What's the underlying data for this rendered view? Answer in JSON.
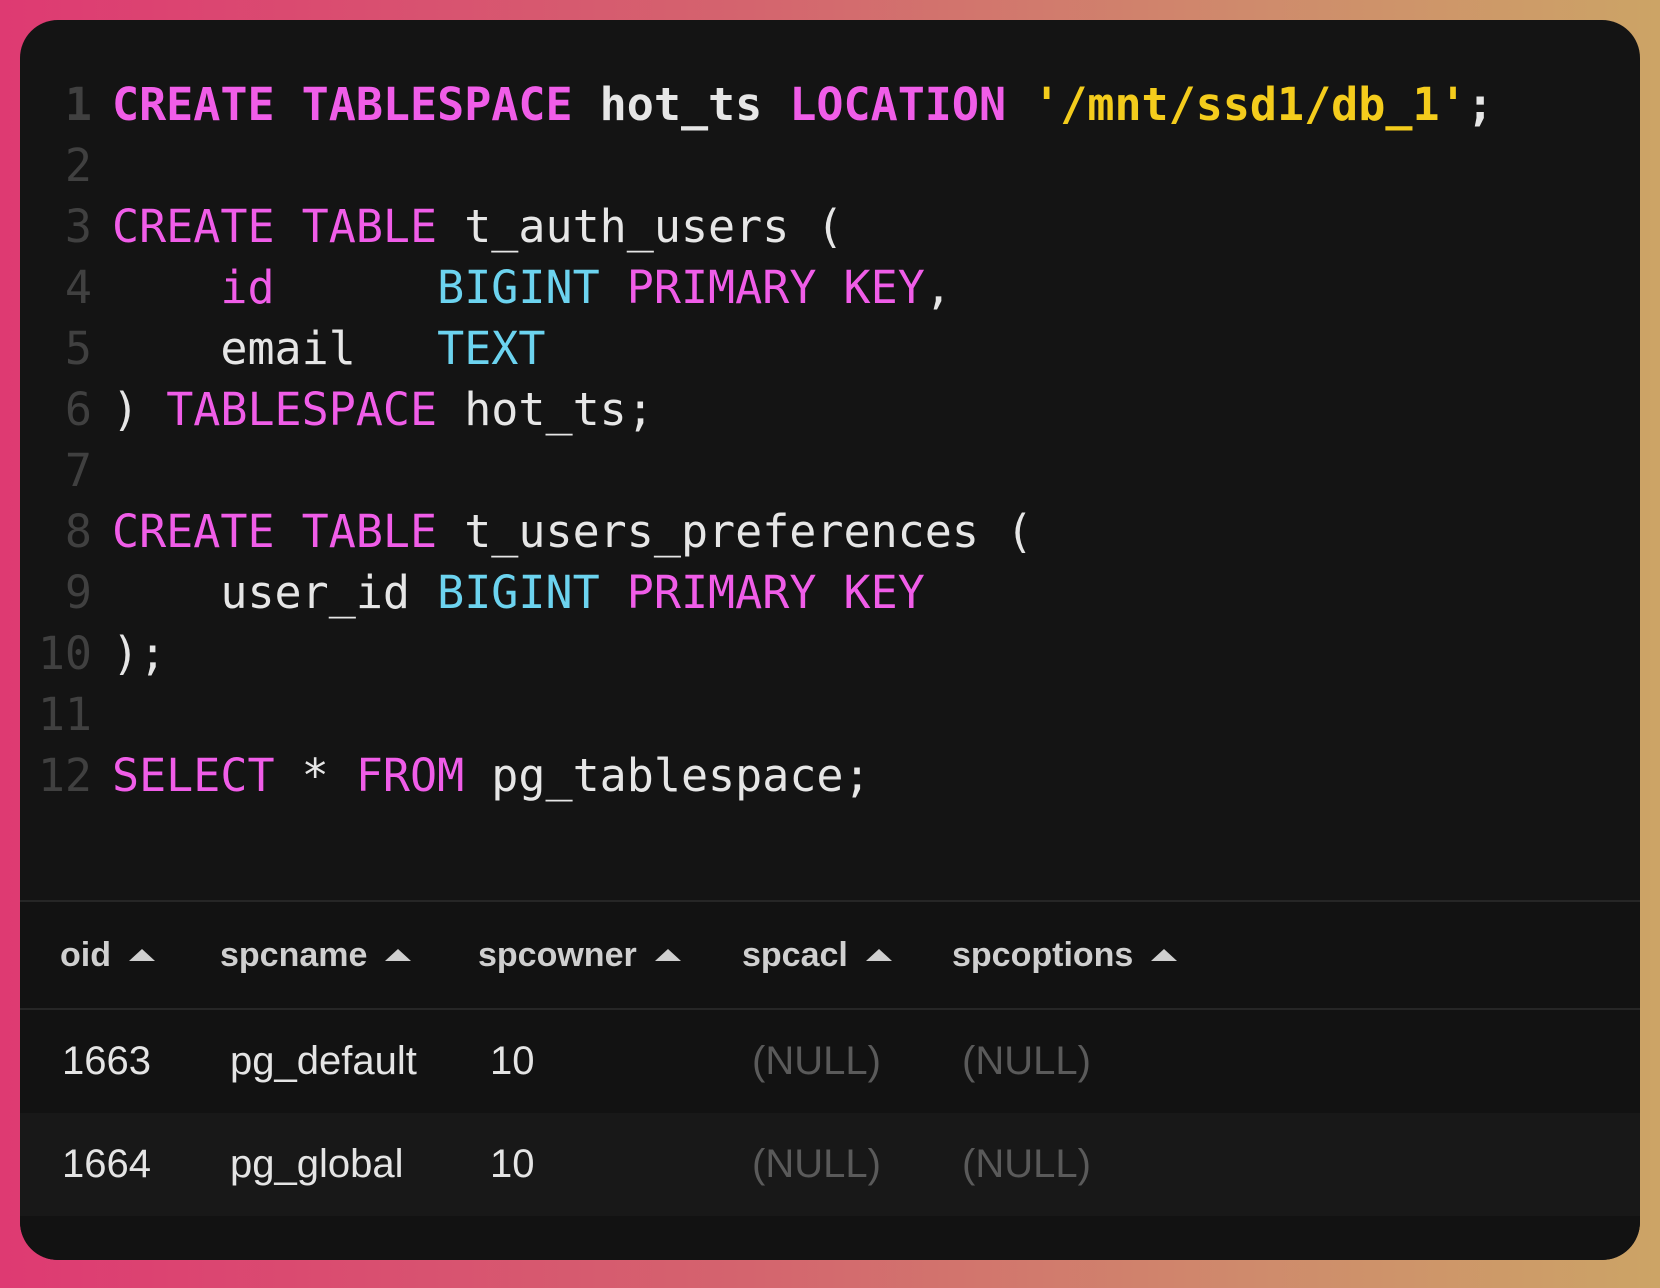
{
  "editor": {
    "lines": [
      {
        "n": "1",
        "tokens": [
          {
            "t": "CREATE TABLESPACE",
            "c": "kw"
          },
          {
            "t": " hot_ts ",
            "c": "code"
          },
          {
            "t": "LOCATION",
            "c": "kw"
          },
          {
            "t": " ",
            "c": "code"
          },
          {
            "t": "'/mnt/ssd1/db_1'",
            "c": "st"
          },
          {
            "t": ";",
            "c": "code"
          }
        ]
      },
      {
        "n": "2",
        "tokens": []
      },
      {
        "n": "3",
        "tokens": [
          {
            "t": "CREATE TABLE",
            "c": "kw"
          },
          {
            "t": " t_auth_users (",
            "c": "code"
          }
        ]
      },
      {
        "n": "4",
        "tokens": [
          {
            "t": "    ",
            "c": "code"
          },
          {
            "t": "id",
            "c": "kw"
          },
          {
            "t": "      ",
            "c": "code"
          },
          {
            "t": "BIGINT",
            "c": "ty"
          },
          {
            "t": " ",
            "c": "code"
          },
          {
            "t": "PRIMARY KEY",
            "c": "kw"
          },
          {
            "t": ",",
            "c": "code"
          }
        ]
      },
      {
        "n": "5",
        "tokens": [
          {
            "t": "    email   ",
            "c": "code"
          },
          {
            "t": "TEXT",
            "c": "ty"
          }
        ]
      },
      {
        "n": "6",
        "tokens": [
          {
            "t": ") ",
            "c": "code"
          },
          {
            "t": "TABLESPACE",
            "c": "kw"
          },
          {
            "t": " hot_ts;",
            "c": "code"
          }
        ]
      },
      {
        "n": "7",
        "tokens": []
      },
      {
        "n": "8",
        "tokens": [
          {
            "t": "CREATE TABLE",
            "c": "kw"
          },
          {
            "t": " t_users_preferences (",
            "c": "code"
          }
        ]
      },
      {
        "n": "9",
        "tokens": [
          {
            "t": "    user_id ",
            "c": "code"
          },
          {
            "t": "BIGINT",
            "c": "ty"
          },
          {
            "t": " ",
            "c": "code"
          },
          {
            "t": "PRIMARY KEY",
            "c": "kw"
          }
        ]
      },
      {
        "n": "10",
        "tokens": [
          {
            "t": ");",
            "c": "code"
          }
        ]
      },
      {
        "n": "11",
        "tokens": []
      },
      {
        "n": "12",
        "tokens": [
          {
            "t": "SELECT",
            "c": "kw"
          },
          {
            "t": " * ",
            "c": "code"
          },
          {
            "t": "FROM",
            "c": "kw"
          },
          {
            "t": " pg_tablespace;",
            "c": "code"
          }
        ]
      }
    ]
  },
  "results": {
    "columns": [
      "oid",
      "spcname",
      "spcowner",
      "spcacl",
      "spcoptions"
    ],
    "rows": [
      [
        "1663",
        "pg_default",
        "10",
        "(NULL)",
        "(NULL)"
      ],
      [
        "1664",
        "pg_global",
        "10",
        "(NULL)",
        "(NULL)"
      ]
    ]
  }
}
